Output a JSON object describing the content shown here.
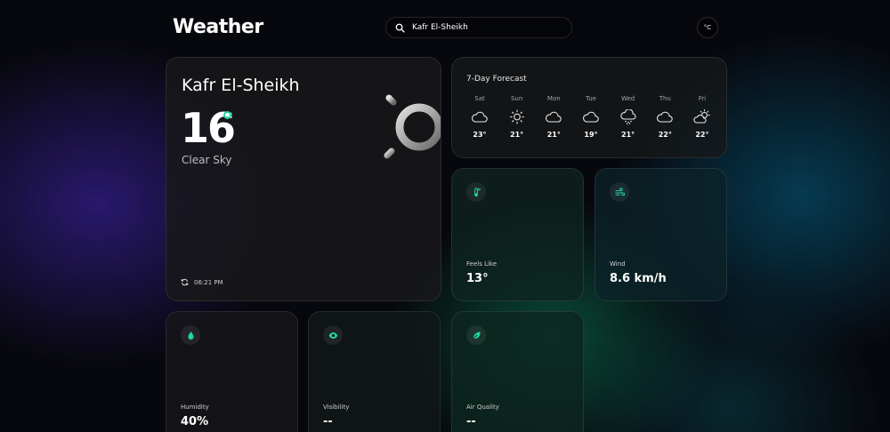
{
  "app": {
    "title": "Weather"
  },
  "search": {
    "value": "Kafr El-Sheikh",
    "icon": "search-icon"
  },
  "unit_toggle": {
    "label": "°C"
  },
  "current": {
    "city": "Kafr El-Sheikh",
    "temperature": "16",
    "condition": "Clear Sky",
    "updated": "06:21 PM",
    "icon": "sun-icon"
  },
  "forecast": {
    "title": "7-Day Forecast",
    "days": [
      {
        "name": "Sat",
        "temp": "23°",
        "icon": "cloud"
      },
      {
        "name": "Sun",
        "temp": "21°",
        "icon": "sun"
      },
      {
        "name": "Mon",
        "temp": "21°",
        "icon": "cloud"
      },
      {
        "name": "Tue",
        "temp": "19°",
        "icon": "cloud"
      },
      {
        "name": "Wed",
        "temp": "21°",
        "icon": "snow"
      },
      {
        "name": "Thu",
        "temp": "22°",
        "icon": "cloud"
      },
      {
        "name": "Fri",
        "temp": "22°",
        "icon": "partly-cloudy"
      }
    ]
  },
  "metrics": {
    "feels_like": {
      "label": "Feels Like",
      "value": "13°"
    },
    "wind": {
      "label": "Wind",
      "value": "8.6 km/h"
    },
    "humidity": {
      "label": "Humidity",
      "value": "40%"
    },
    "visibility": {
      "label": "Visibility",
      "value": "--"
    },
    "air_quality": {
      "label": "Air Quality",
      "value": "--"
    }
  },
  "colors": {
    "accent": "#1fd8a0",
    "background": "#07080d"
  }
}
